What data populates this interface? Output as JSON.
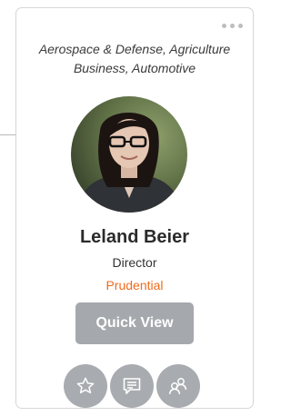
{
  "card": {
    "industries_line1": "Aerospace & Defense, Agriculture",
    "industries_line2": "Business, Automotive",
    "name": "Leland Beier",
    "title": "Director",
    "company": "Prudential",
    "quick_view_label": "Quick View"
  },
  "icons": {
    "more": "more-dots-icon",
    "favorite": "star-icon",
    "message": "message-icon",
    "connections": "connections-icon"
  },
  "colors": {
    "company": "#f26b1d",
    "button": "#a5a8ac",
    "icon_button": "#a8abaf"
  }
}
